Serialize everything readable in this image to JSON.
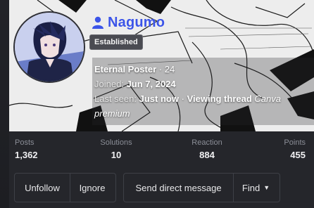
{
  "profile": {
    "username": "Nagumo",
    "badge": "Established",
    "title_label": "Eternal Poster",
    "separator": "·",
    "title_count": "24",
    "joined_label": "Joined:",
    "joined_value": "Jun 7, 2024",
    "last_seen_label": "Last seen:",
    "last_seen_value": "Just now",
    "activity_prefix": "Viewing thread",
    "activity_thread": "Canva premium",
    "accent_color": "#3b54e8"
  },
  "stats": [
    {
      "label": "Posts",
      "value": "1,362"
    },
    {
      "label": "Solutions",
      "value": "10"
    },
    {
      "label": "Reaction",
      "value": "884"
    },
    {
      "label": "Points",
      "value": "455"
    }
  ],
  "actions": {
    "unfollow": "Unfollow",
    "ignore": "Ignore",
    "message": "Send direct message",
    "find": "Find"
  },
  "icons": {
    "user": "user-icon",
    "caret": "caret-down-icon"
  }
}
